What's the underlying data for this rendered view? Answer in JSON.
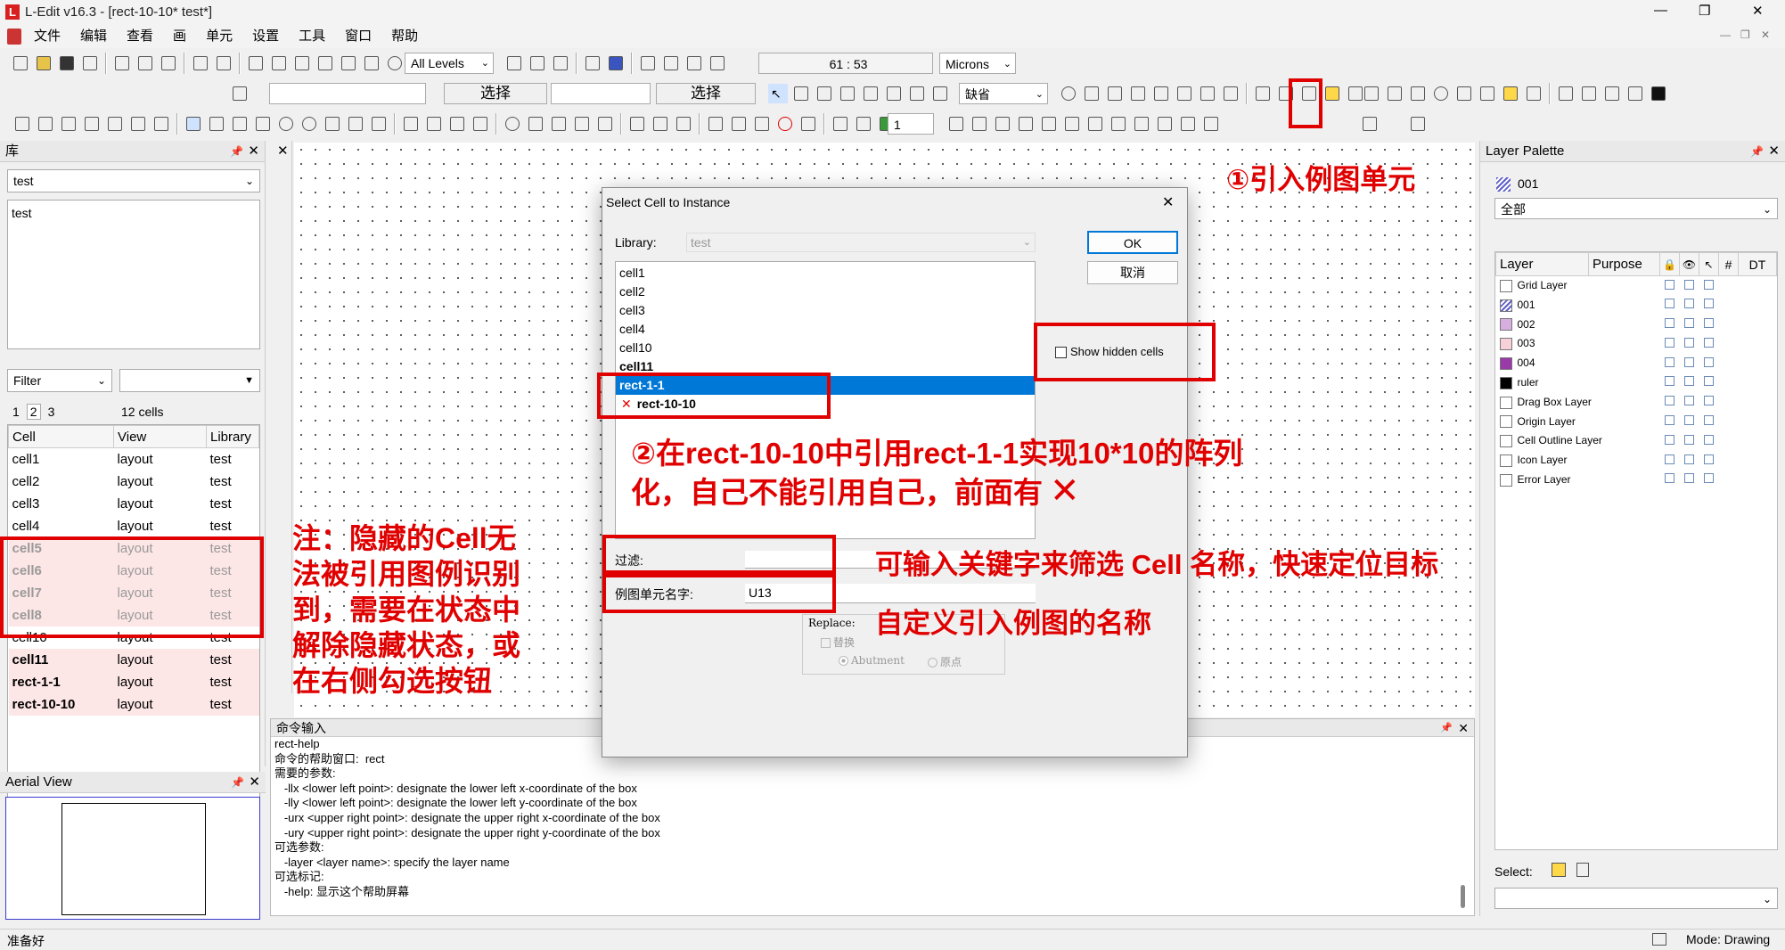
{
  "window": {
    "title": "L-Edit v16.3 - [rect-10-10*    test*]",
    "min": "—",
    "max": "❐",
    "close": "✕",
    "sub_min": "—",
    "sub_max": "❐",
    "sub_close": "✕"
  },
  "menu": [
    "文件",
    "编辑",
    "查看",
    "画",
    "单元",
    "设置",
    "工具",
    "窗口",
    "帮助"
  ],
  "toolbar": {
    "levels": "All Levels",
    "coord": "61 : 53",
    "units": "Microns",
    "select_a": "选择",
    "select_b": "选择",
    "layer_default": "缺省",
    "count": "1"
  },
  "library_panel": {
    "title": "库",
    "selected": "test",
    "list_item": "test",
    "filter_label": "Filter",
    "tabs": [
      "1",
      "2",
      "3"
    ],
    "count": "12 cells",
    "columns": [
      "Cell",
      "View",
      "Library"
    ],
    "rows": [
      {
        "cell": "cell1",
        "view": "layout",
        "lib": "test",
        "hidden": false,
        "bold": false
      },
      {
        "cell": "cell2",
        "view": "layout",
        "lib": "test",
        "hidden": false,
        "bold": false
      },
      {
        "cell": "cell3",
        "view": "layout",
        "lib": "test",
        "hidden": false,
        "bold": false
      },
      {
        "cell": "cell4",
        "view": "layout",
        "lib": "test",
        "hidden": false,
        "bold": false
      },
      {
        "cell": "cell5",
        "view": "layout",
        "lib": "test",
        "hidden": true,
        "bold": true
      },
      {
        "cell": "cell6",
        "view": "layout",
        "lib": "test",
        "hidden": true,
        "bold": true
      },
      {
        "cell": "cell7",
        "view": "layout",
        "lib": "test",
        "hidden": true,
        "bold": true
      },
      {
        "cell": "cell8",
        "view": "layout",
        "lib": "test",
        "hidden": true,
        "bold": true
      },
      {
        "cell": "cell10",
        "view": "layout",
        "lib": "test",
        "hidden": false,
        "bold": false
      },
      {
        "cell": "cell11",
        "view": "layout",
        "lib": "test",
        "hidden": false,
        "bold": true
      },
      {
        "cell": "rect-1-1",
        "view": "layout",
        "lib": "test",
        "hidden": false,
        "bold": true
      },
      {
        "cell": "rect-10-10",
        "view": "layout",
        "lib": "test",
        "hidden": false,
        "bold": true
      }
    ]
  },
  "aerial": {
    "title": "Aerial View"
  },
  "dialog": {
    "title": "Select Cell to Instance",
    "library_label": "Library:",
    "library_value": "test",
    "ok": "OK",
    "cancel": "取消",
    "cells": [
      "cell1",
      "cell2",
      "cell3",
      "cell4",
      "cell10",
      "cell11",
      "rect-1-1",
      "rect-10-10"
    ],
    "selected": "rect-1-1",
    "show_hidden": "Show hidden cells",
    "filter_label": "过滤:",
    "name_label": "例图单元名字:",
    "name_value": "U13",
    "replace_label": "Replace:",
    "replace_check": "替换",
    "abutment": "Abutment",
    "origin": "原点"
  },
  "command": {
    "title": "命令输入",
    "lines": [
      "rect-help",
      "命令的帮助窗口:  rect",
      "需要的参数:",
      "   -llx <lower left point>: designate the lower left x-coordinate of the box",
      "   -lly <lower left point>: designate the lower left y-coordinate of the box",
      "   -urx <upper right point>: designate the upper right x-coordinate of the box",
      "   -ury <upper right point>: designate the upper right y-coordinate of the box",
      "可选参数:",
      "   -layer <layer name>: specify the layer name",
      "可选标记:",
      "   -help: 显示这个帮助屏幕"
    ]
  },
  "layer_palette": {
    "title": "Layer Palette",
    "current": "001",
    "filter": "全部",
    "columns": [
      "Layer",
      "Purpose",
      "#",
      "DT"
    ],
    "layers": [
      {
        "name": "Grid Layer",
        "color": "#ffffff"
      },
      {
        "name": "001",
        "color": "#8f8fd6"
      },
      {
        "name": "002",
        "color": "#d6aee0"
      },
      {
        "name": "003",
        "color": "#f8d0d8"
      },
      {
        "name": "004",
        "color": "#9a3aa8"
      },
      {
        "name": "ruler",
        "color": "#000000"
      },
      {
        "name": "Drag Box Layer",
        "color": "#ffffff"
      },
      {
        "name": "Origin Layer",
        "color": "#ffffff"
      },
      {
        "name": "Cell Outline Layer",
        "color": "#ffffff"
      },
      {
        "name": "Icon Layer",
        "color": "#ffffff"
      },
      {
        "name": "Error Layer",
        "color": "#ffffff"
      }
    ],
    "select_label": "Select:"
  },
  "status": {
    "left": "准备好",
    "right": "Mode: Drawing"
  },
  "annotations": {
    "a1": "①引入例图单元",
    "a2_line1": "②在rect-10-10中引用rect-1-1实现10*10的阵列",
    "a2_line2": "化，自己不能引用自己，前面有",
    "a2_mark": "✕",
    "note_lines": [
      "注：隐藏的Cell无",
      "法被引用图例识别",
      "到，需要在状态中",
      "解除隐藏状态，或",
      "在右侧勾选按钮"
    ],
    "filter_tip": "可输入关键字来筛选 Cell 名称，快速定位目标",
    "name_tip": "自定义引入例图的名称"
  },
  "colors": {
    "accent_red": "#e00000",
    "selection": "#0078d7"
  }
}
